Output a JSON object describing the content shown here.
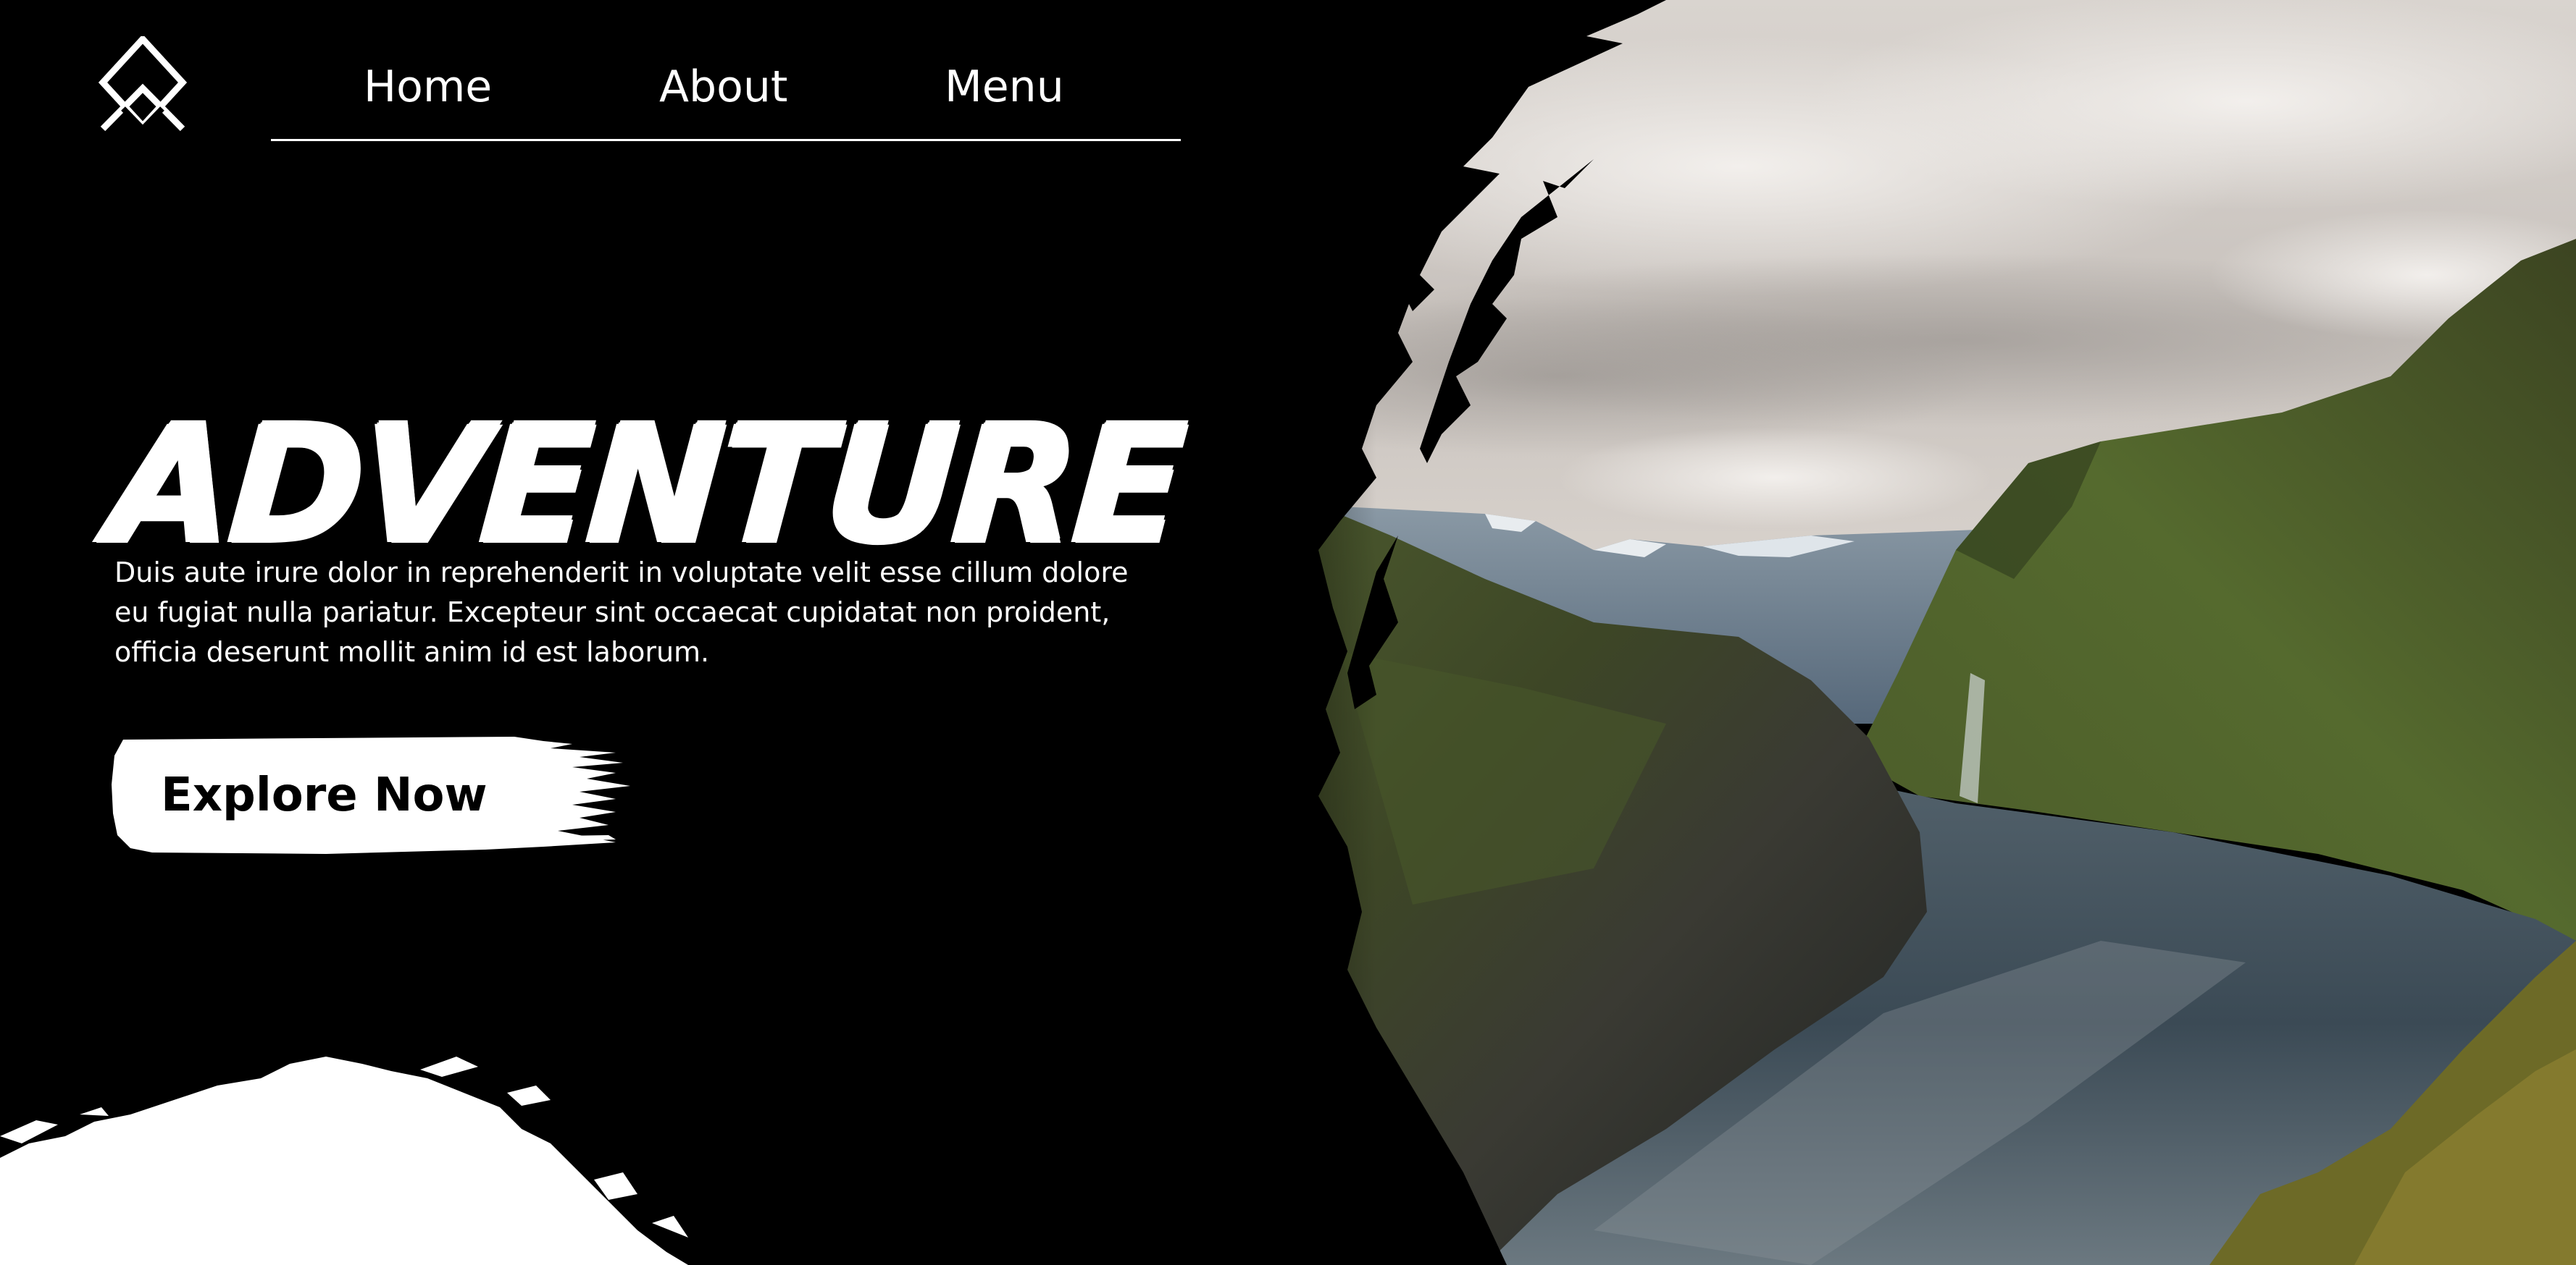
{
  "nav": {
    "items": [
      {
        "label": "Home"
      },
      {
        "label": "About"
      },
      {
        "label": "Menu"
      }
    ]
  },
  "hero": {
    "title": "ADVENTURE",
    "description_lines": [
      "Duis aute irure dolor in reprehenderit in voluptate velit esse cillum dolore",
      "eu fugiat nulla pariatur. Excepteur sint occaecat cupidatat non proident,",
      "officia deserunt mollit anim id est laborum."
    ],
    "cta_label": "Explore Now"
  },
  "icons": {
    "logo": "diamond-mountain-logo"
  },
  "colors": {
    "background": "#000000",
    "text": "#ffffff",
    "button_bg": "#ffffff",
    "button_text": "#000000"
  }
}
